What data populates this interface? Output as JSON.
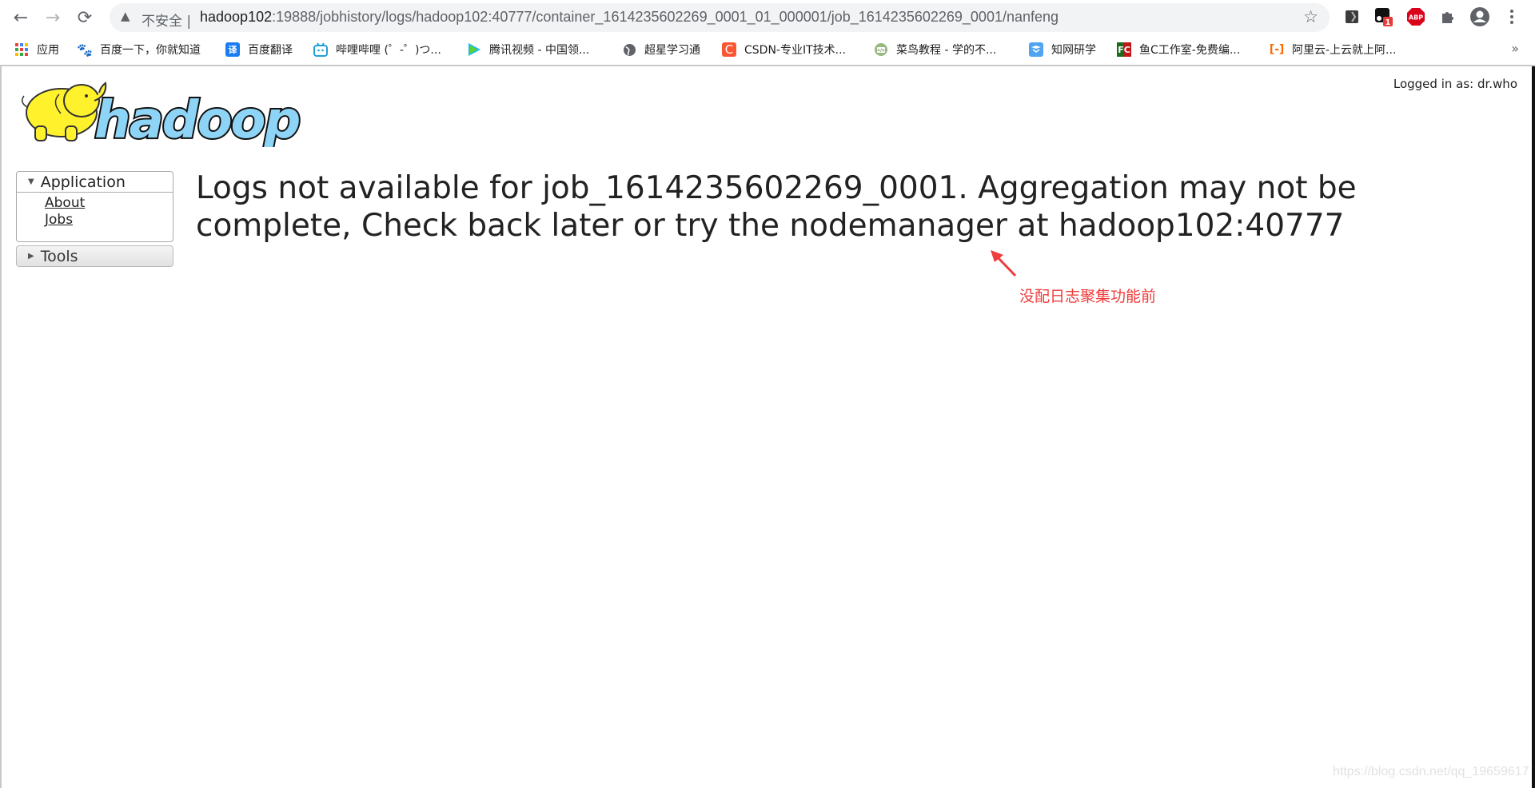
{
  "browser": {
    "nav": {
      "back": "←",
      "forward": "→",
      "reload": "⟳"
    },
    "omnibox": {
      "warning_icon": "warning-triangle",
      "insecure_label": "不安全",
      "separator": "|",
      "url_host": "hadoop102",
      "url_rest": ":19888/jobhistory/logs/hadoop102:40777/container_1614235602269_0001_01_000001/job_1614235602269_0001/nanfeng",
      "star_icon": "☆"
    },
    "extensions": [
      {
        "name": "extension-1"
      },
      {
        "name": "extension-2",
        "badge": "1"
      },
      {
        "name": "adblock-plus",
        "label": "ABP"
      },
      {
        "name": "extensions-puzzle"
      },
      {
        "name": "profile-avatar"
      },
      {
        "name": "menu-kebab"
      }
    ],
    "bookmarks": [
      {
        "label": "应用",
        "icon": "apps-grid"
      },
      {
        "label": "百度一下，你就知道",
        "icon": "baidu-paw"
      },
      {
        "label": "百度翻译",
        "icon": "translate",
        "glyph": "译"
      },
      {
        "label": "哔哩哔哩 (゜-゜)つ...",
        "icon": "bilibili"
      },
      {
        "label": "腾讯视频 - 中国领...",
        "icon": "tencent-video"
      },
      {
        "label": "超星学习通",
        "icon": "globe"
      },
      {
        "label": "CSDN-专业IT技术...",
        "icon": "csdn",
        "glyph": "C"
      },
      {
        "label": "菜鸟教程 - 学的不...",
        "icon": "runoob"
      },
      {
        "label": "知网研学",
        "icon": "cnki"
      },
      {
        "label": "鱼C工作室-免费编...",
        "icon": "fishc",
        "glyph": "FC"
      },
      {
        "label": "阿里云-上云就上阿...",
        "icon": "aliyun",
        "glyph": "[-]"
      }
    ],
    "more_bookmarks": "»"
  },
  "page": {
    "logged_in": "Logged in as: dr.who",
    "logo_text": "hadoop",
    "sidebar": {
      "application": {
        "title": "Application",
        "links": [
          "About",
          "Jobs"
        ]
      },
      "tools": {
        "title": "Tools"
      }
    },
    "message": "Logs not available for job_1614235602269_0001. Aggregation may not be complete, Check back later or try the nodemanager at hadoop102:40777",
    "annotation": {
      "text": "没配日志聚集功能前",
      "color": "#f03c3c"
    },
    "watermark": "https://blog.csdn.net/qq_19659617"
  }
}
